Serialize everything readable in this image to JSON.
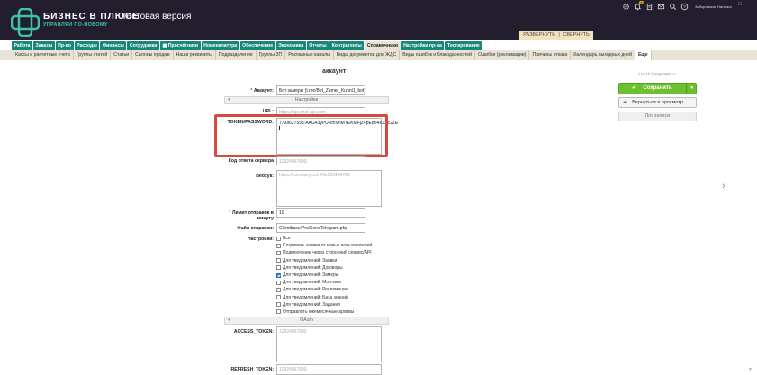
{
  "header": {
    "brand": "БИЗНЕС В ПЛЮСЕ",
    "tagline": "УПРАВЛЯЙ ПО-НОВОМУ",
    "test_version": "Тестовая версия",
    "expand": "РАЗВЕРНУТЬ",
    "separator": "|",
    "collapse": "СВЕРНУТЬ",
    "notification_count": "44",
    "user_name": "Заборовская Наталья",
    "window_controls": "– □"
  },
  "main_nav": [
    {
      "label": "Работа"
    },
    {
      "label": "Заказы"
    },
    {
      "label": "Пр-во"
    },
    {
      "label": "Расходы"
    },
    {
      "label": "Финансы"
    },
    {
      "label": "Сотрудники"
    },
    {
      "label": "Просчётники"
    },
    {
      "label": "Номенклатура"
    },
    {
      "label": "Обеспечение"
    },
    {
      "label": "Экономика"
    },
    {
      "label": "Отчеты"
    },
    {
      "label": "Контрагенты"
    },
    {
      "label": "Справочники"
    },
    {
      "label": "Настройки пр-ва"
    },
    {
      "label": "Тестирование"
    }
  ],
  "sub_nav": [
    {
      "label": "Кассы и расчетные счета"
    },
    {
      "label": "Группы статей"
    },
    {
      "label": "Статьи"
    },
    {
      "label": "Салоны продаж"
    },
    {
      "label": "Наши реквизиты"
    },
    {
      "label": "Подразделения"
    },
    {
      "label": "Группы ЗП"
    },
    {
      "label": "Рекламные каналы"
    },
    {
      "label": "Виды документов для ЖДС"
    },
    {
      "label": "Виды ошибок и благодарностей"
    },
    {
      "label": "Ошибки (рекламации)"
    },
    {
      "label": "Причины отказа"
    },
    {
      "label": "Календарь выходных дней"
    },
    {
      "label": "Еще"
    }
  ],
  "page": {
    "title": "аккаунт",
    "pager": "1 из 16 Следующая >>"
  },
  "form": {
    "account_label": "Аккаунт:",
    "account_value": "Бот замеры (t.me/Bot_Zamer_Kuhni1_bot)",
    "settings_section": "Настройки",
    "url_label": "URL:",
    "url_placeholder": "https://api.chat-api.com",
    "token_label": "TOKEN/PASSWORD:",
    "token_value": "7738627595:AAG43yPURmVnMTEKMFjZ4pE8rI4xXXc2ZE",
    "reply_code_label": "Код ответа сервера",
    "reply_code_placeholder": "12324567890",
    "webhook_label": "Вебхук:",
    "webhook_placeholder": "https://company.com/file123456789",
    "limit_label": "Лимит отправок в минуту",
    "limit_value": "10",
    "send_file_label": "Файл отправки:",
    "send_file_value": "Clientbase/Pro/SendTelegram.php",
    "settings_label": "Настройки:",
    "options": [
      {
        "label": "Все",
        "checked": false
      },
      {
        "label": "Создавать заявки от новых пользователей",
        "checked": false
      },
      {
        "label": "Подключение через сторонний сервис/API",
        "checked": false
      },
      {
        "label": "Для уведомлений: Заявки",
        "checked": false
      },
      {
        "label": "Для уведомлений: Договоры",
        "checked": false
      },
      {
        "label": "Для уведомлений: Замеры",
        "checked": true
      },
      {
        "label": "Для уведомлений: Монтажи",
        "checked": false
      },
      {
        "label": "Для уведомлений: Рекламации",
        "checked": false
      },
      {
        "label": "Для уведомлений: База знаний",
        "checked": false
      },
      {
        "label": "Для уведомлений: Задания",
        "checked": false
      },
      {
        "label": "Отправлять ежемесячные архивы",
        "checked": false
      }
    ],
    "oauth_section": "OAuth",
    "access_token_label": "ACCESS_TOKEN:",
    "access_token_placeholder": "12324567890",
    "refresh_token_label": "REFRESH_TOKEN:",
    "refresh_token_placeholder": "12324567890"
  },
  "actions": {
    "save": "Сохранить",
    "back": "Вернуться в просмотр",
    "log": "Лог записи"
  },
  "colors": {
    "header_bg": "#231e2e",
    "nav_tab": "#16877a",
    "save_green": "#6cbf2e",
    "highlight_red": "#d6493e"
  }
}
